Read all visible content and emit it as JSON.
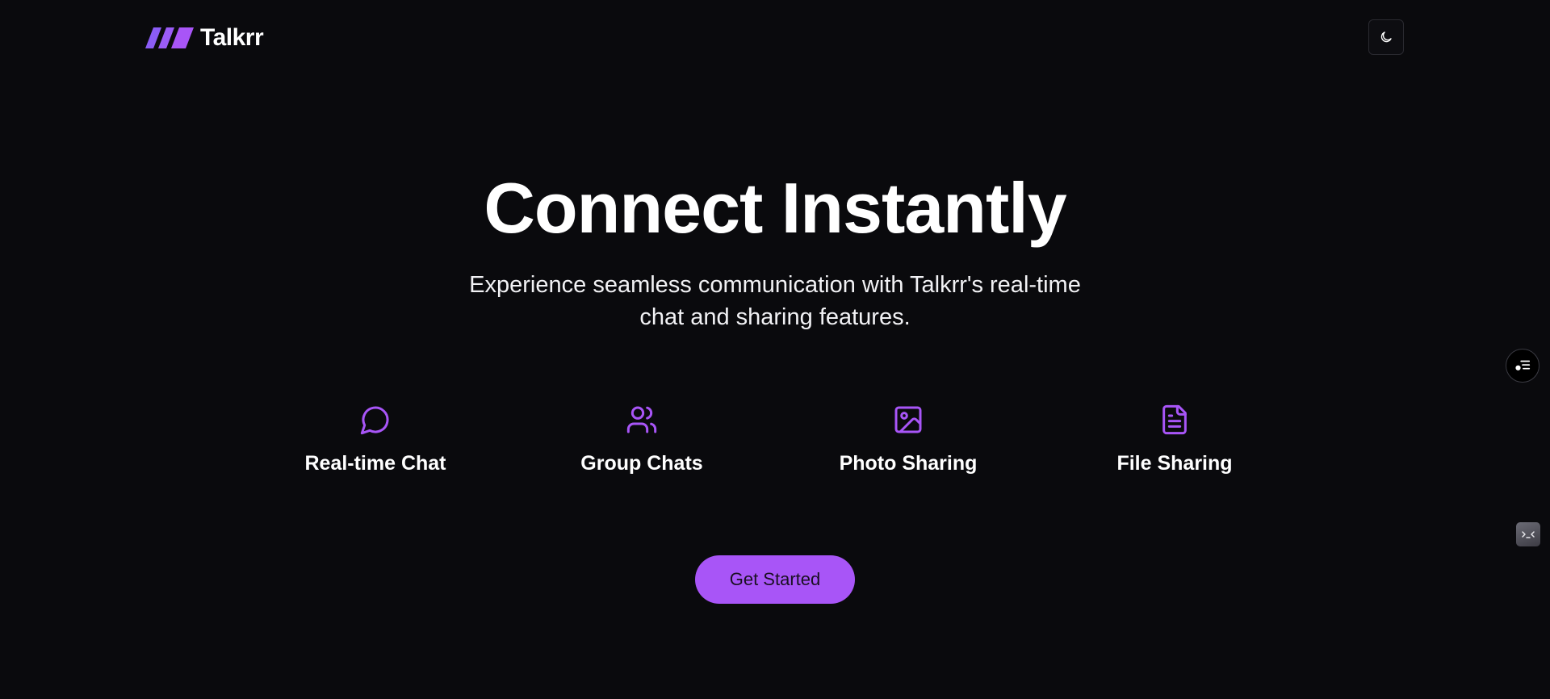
{
  "colors": {
    "background": "#0a0a0d",
    "accent": "#a855f7",
    "text": "#ffffff"
  },
  "header": {
    "brand": "Talkrr",
    "logo_icon": "slanted-bars-logo",
    "theme_toggle_icon": "moon-icon"
  },
  "hero": {
    "title": "Connect Instantly",
    "subtitle": "Experience seamless communication with Talkrr's real-time chat and sharing features."
  },
  "features": [
    {
      "label": "Real-time Chat",
      "icon": "chat-bubble-icon"
    },
    {
      "label": "Group Chats",
      "icon": "users-icon"
    },
    {
      "label": "Photo Sharing",
      "icon": "image-icon"
    },
    {
      "label": "File Sharing",
      "icon": "file-text-icon"
    }
  ],
  "cta": {
    "label": "Get Started"
  },
  "floating": {
    "toc_icon": "list-settings-icon",
    "dev_icon": "dev-tools-icon"
  }
}
